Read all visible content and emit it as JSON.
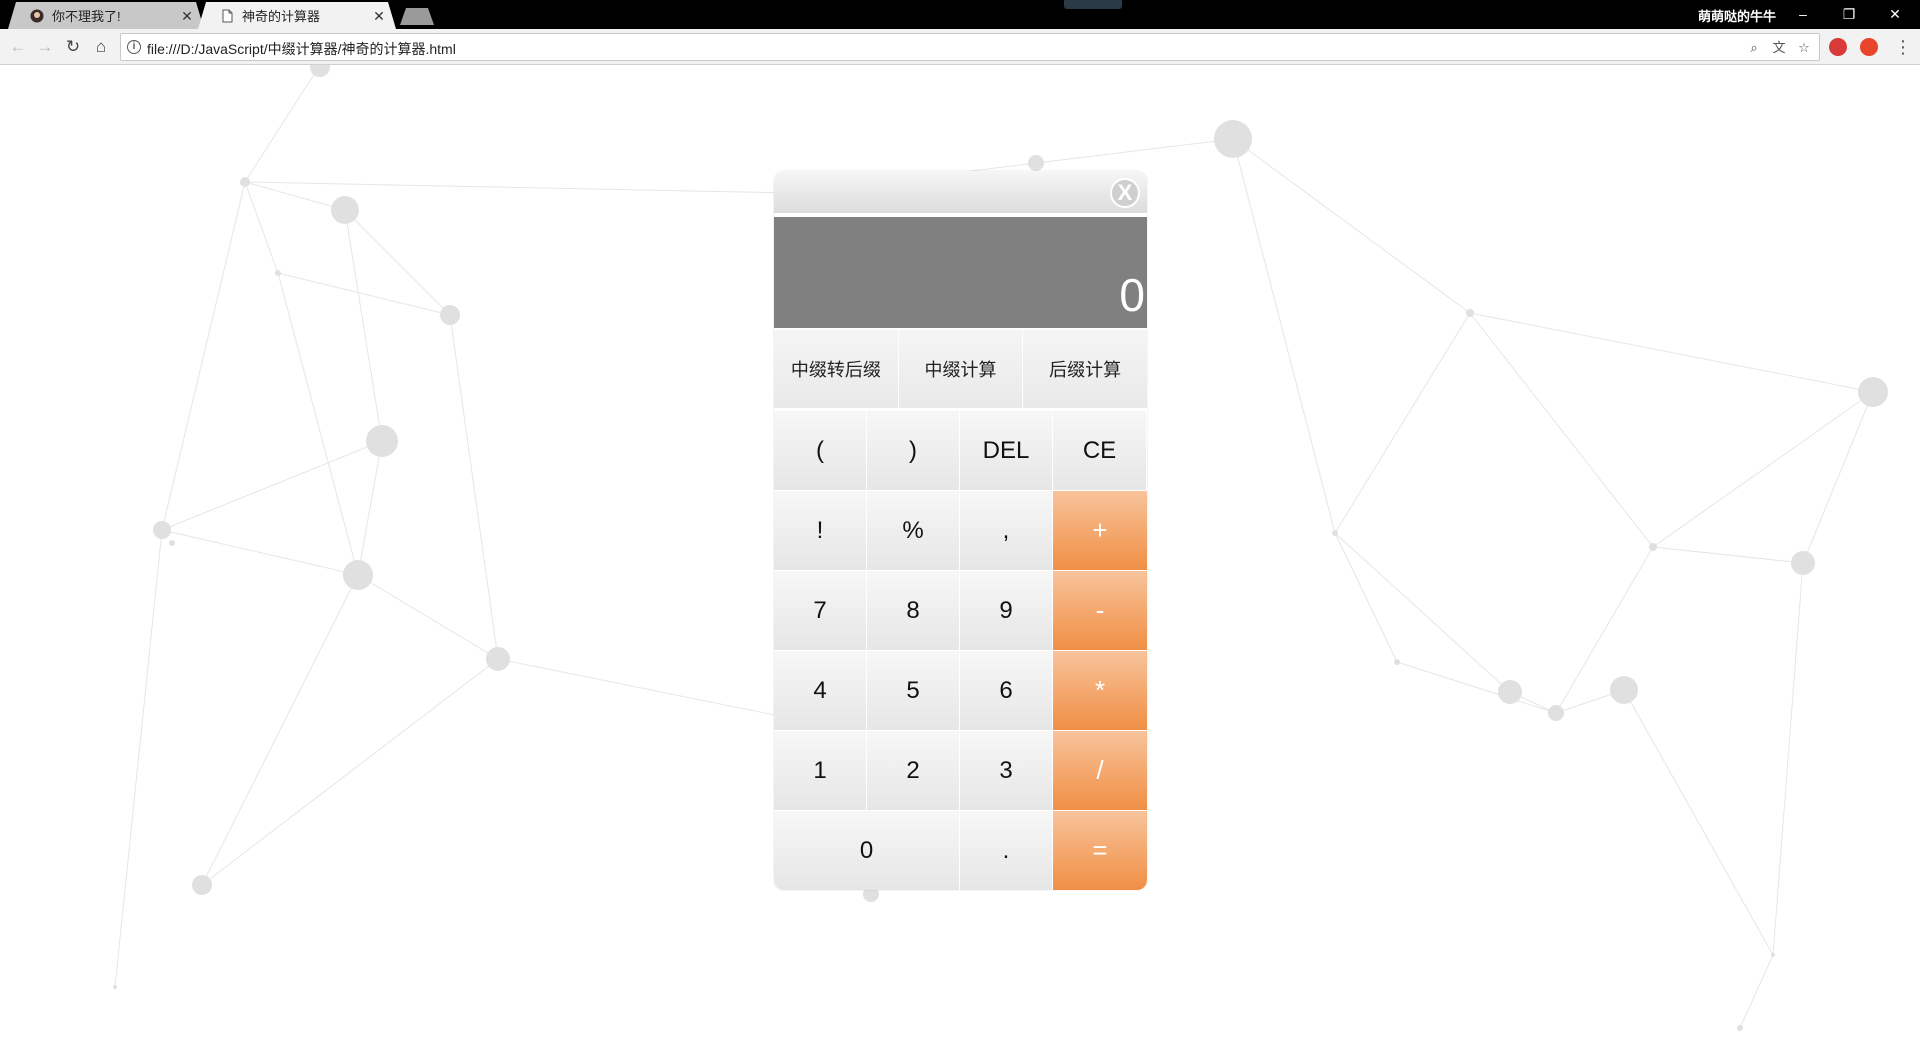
{
  "browser": {
    "tabs": [
      {
        "title": "你不理我了!",
        "active": false
      },
      {
        "title": "神奇的计算器",
        "active": true
      }
    ],
    "close_glyph": "✕",
    "user_name": "萌萌哒的牛牛",
    "window_controls": {
      "minimize": "–",
      "restore": "❐",
      "close": "✕"
    },
    "url": "file:///D:/JavaScript/中缀计算器/神奇的计算器.html",
    "info_glyph": "i"
  },
  "calculator": {
    "close_label": "X",
    "display_value": "0",
    "modes": [
      "中缀转后缀",
      "中缀计算",
      "后缀计算"
    ],
    "keys": [
      {
        "label": "(",
        "type": "num"
      },
      {
        "label": ")",
        "type": "num"
      },
      {
        "label": "DEL",
        "type": "num"
      },
      {
        "label": "CE",
        "type": "num"
      },
      {
        "label": "!",
        "type": "num"
      },
      {
        "label": "%",
        "type": "num"
      },
      {
        "label": ",",
        "type": "num"
      },
      {
        "label": "+",
        "type": "op"
      },
      {
        "label": "7",
        "type": "num"
      },
      {
        "label": "8",
        "type": "num"
      },
      {
        "label": "9",
        "type": "num"
      },
      {
        "label": "-",
        "type": "op"
      },
      {
        "label": "4",
        "type": "num"
      },
      {
        "label": "5",
        "type": "num"
      },
      {
        "label": "6",
        "type": "num"
      },
      {
        "label": "*",
        "type": "op"
      },
      {
        "label": "1",
        "type": "num"
      },
      {
        "label": "2",
        "type": "num"
      },
      {
        "label": "3",
        "type": "num"
      },
      {
        "label": "/",
        "type": "op"
      },
      {
        "label": "0",
        "type": "zero"
      },
      {
        "label": ".",
        "type": "num"
      },
      {
        "label": "=",
        "type": "op"
      }
    ]
  },
  "colors": {
    "operator_key": "#f08f45",
    "display_bg": "#808080",
    "titlebar": "#000000"
  }
}
